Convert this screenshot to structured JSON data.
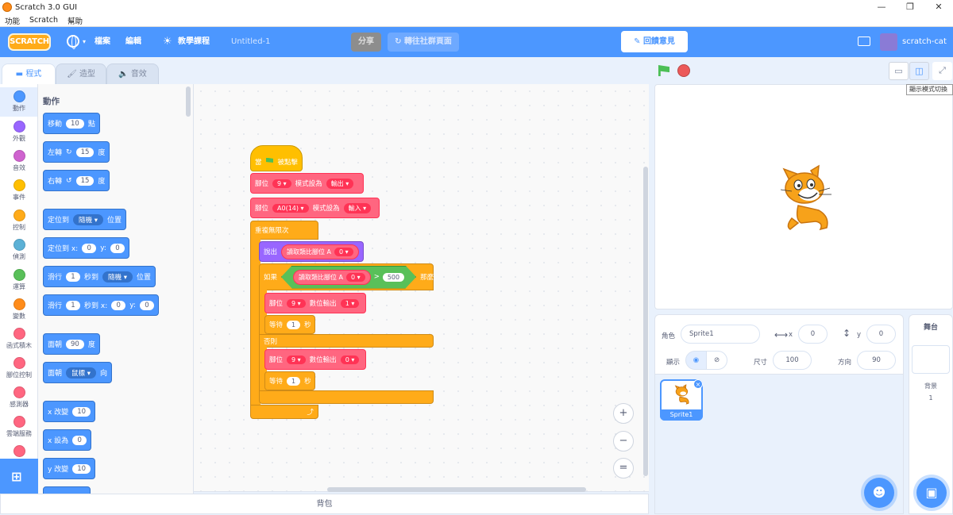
{
  "window": {
    "title": "Scratch 3.0 GUI",
    "controls": [
      "—",
      "❐",
      "✕"
    ]
  },
  "menubar": [
    "功能",
    "Scratch",
    "幫助"
  ],
  "header": {
    "logo": "SCRATCH",
    "file": "檔案",
    "edit": "編輯",
    "tutorials": "教學課程",
    "project_title": "Untitled-1",
    "share": "分享",
    "see_community": "轉往社群頁面",
    "feedback": "回饋意見",
    "username": "scratch-cat"
  },
  "tabs": {
    "code": "程式",
    "costumes": "造型",
    "sounds": "音效"
  },
  "categories": [
    {
      "label": "動作",
      "color": "#4c97ff"
    },
    {
      "label": "外觀",
      "color": "#9966ff"
    },
    {
      "label": "音效",
      "color": "#cf63cf"
    },
    {
      "label": "事件",
      "color": "#ffbf00"
    },
    {
      "label": "控制",
      "color": "#ffab19"
    },
    {
      "label": "偵測",
      "color": "#5cb1d6"
    },
    {
      "label": "運算",
      "color": "#59c059"
    },
    {
      "label": "變數",
      "color": "#ff8c1a"
    },
    {
      "label": "函式積木",
      "color": "#ff6680"
    },
    {
      "label": "腳位控制",
      "color": "#ff6680"
    },
    {
      "label": "感測器",
      "color": "#ff6680"
    },
    {
      "label": "雲端服務",
      "color": "#ff6680"
    }
  ],
  "palette": {
    "heading": "動作",
    "move": {
      "a": "移動",
      "v": "10",
      "b": "點"
    },
    "turn_right": {
      "a": "左轉",
      "icon": "↻",
      "v": "15",
      "b": "度"
    },
    "turn_left": {
      "a": "右轉",
      "icon": "↺",
      "v": "15",
      "b": "度"
    },
    "goto_random": {
      "a": "定位到",
      "dd": "隨機",
      "b": "位置"
    },
    "goto_xy": {
      "a": "定位到 x:",
      "x": "0",
      "b": "y:",
      "y": "0"
    },
    "glide_random": {
      "a": "滑行",
      "v": "1",
      "b": "秒到",
      "dd": "隨機",
      "c": "位置"
    },
    "glide_xy": {
      "a": "滑行",
      "v": "1",
      "b": "秒到 x:",
      "x": "0",
      "c": "y:",
      "y": "0"
    },
    "point_dir": {
      "a": "面朝",
      "v": "90",
      "b": "度"
    },
    "point_towards": {
      "a": "面朝",
      "dd": "鼠標",
      "b": "向"
    },
    "change_x": {
      "a": "x 改變",
      "v": "10"
    },
    "set_x": {
      "a": "x 設為",
      "v": "0"
    },
    "change_y": {
      "a": "y 改變",
      "v": "10"
    }
  },
  "script": {
    "hat": {
      "a": "當",
      "b": "被點擊"
    },
    "pin_mode1": {
      "a": "腳位",
      "pin": "9",
      "b": "模式設為",
      "mode": "輸出"
    },
    "pin_mode2": {
      "a": "腳位",
      "pin": "A0(14)",
      "b": "模式設為",
      "mode": "輸入"
    },
    "forever": "重複無限次",
    "say": {
      "a": "說出",
      "r": "讀取類比腳位 A",
      "v": "0"
    },
    "if": {
      "a": "如果",
      "r": "讀取類比腳位 A",
      "v": "0",
      "op": ">",
      "n": "500",
      "b": "那麼"
    },
    "dw1": {
      "a": "腳位",
      "pin": "9",
      "b": "數位輸出",
      "val": "1"
    },
    "wait1": {
      "a": "等待",
      "v": "1",
      "b": "秒"
    },
    "else": "否則",
    "dw2": {
      "a": "腳位",
      "pin": "9",
      "b": "數位輸出",
      "val": "0"
    },
    "wait2": {
      "a": "等待",
      "v": "1",
      "b": "秒"
    },
    "loop_arrow": "⤴"
  },
  "zoom": {
    "in": "+",
    "out": "−",
    "reset": "="
  },
  "backpack": "背包",
  "stage": {
    "tooltip": "顯示模式切換"
  },
  "sprite_info": {
    "sprite_label": "角色",
    "sprite_name": "Sprite1",
    "x_label": "x",
    "x": "0",
    "y_label": "y",
    "y": "0",
    "show_label": "顯示",
    "size_label": "尺寸",
    "size": "100",
    "direction_label": "方向",
    "direction": "90"
  },
  "sprites": [
    {
      "name": "Sprite1"
    }
  ],
  "stage_panel": {
    "title": "舞台",
    "backdrops_label": "背景",
    "backdrops": "1"
  }
}
